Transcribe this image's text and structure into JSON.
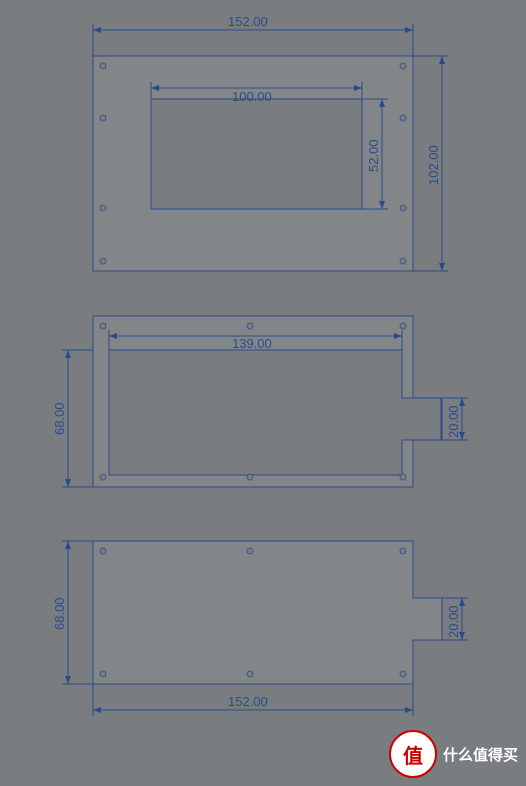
{
  "part1": {
    "width": "152.00",
    "height": "102.00",
    "inner_width": "100.00",
    "inner_height": "52.00"
  },
  "part2": {
    "inner_width": "139.00",
    "height": "68.00",
    "notch_height": "20.00"
  },
  "part3": {
    "width": "152.00",
    "height": "68.00",
    "notch_height": "20.00"
  },
  "watermark": {
    "symbol": "值",
    "text": "什么值得买"
  }
}
